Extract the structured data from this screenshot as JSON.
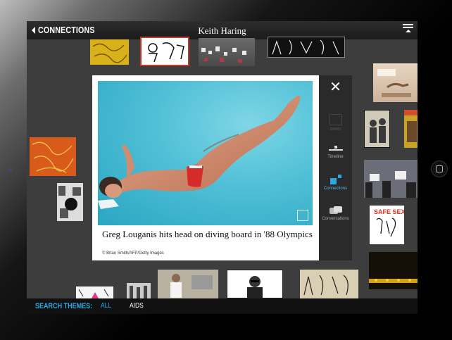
{
  "header": {
    "back_label": "CONNECTIONS",
    "title": "Keith Haring"
  },
  "modal": {
    "caption": "Greg Louganis hits head on diving board in '88 Olympics",
    "credit": "© Brian Smith/AFP/Getty Images",
    "sidebar": [
      {
        "label": "Artists",
        "icon": "easel-icon"
      },
      {
        "label": "Timeline",
        "icon": "timeline-icon"
      },
      {
        "label": "Connections",
        "icon": "connections-icon"
      },
      {
        "label": "Conversations",
        "icon": "conversations-icon"
      }
    ]
  },
  "search_themes": {
    "label": "SEARCH THEMES:",
    "items": [
      "ALL",
      "AIDS"
    ],
    "active": "ALL"
  },
  "colors": {
    "accent": "#2aa9e0",
    "bar": "#111111",
    "screen_bg": "#3d3d3d"
  }
}
